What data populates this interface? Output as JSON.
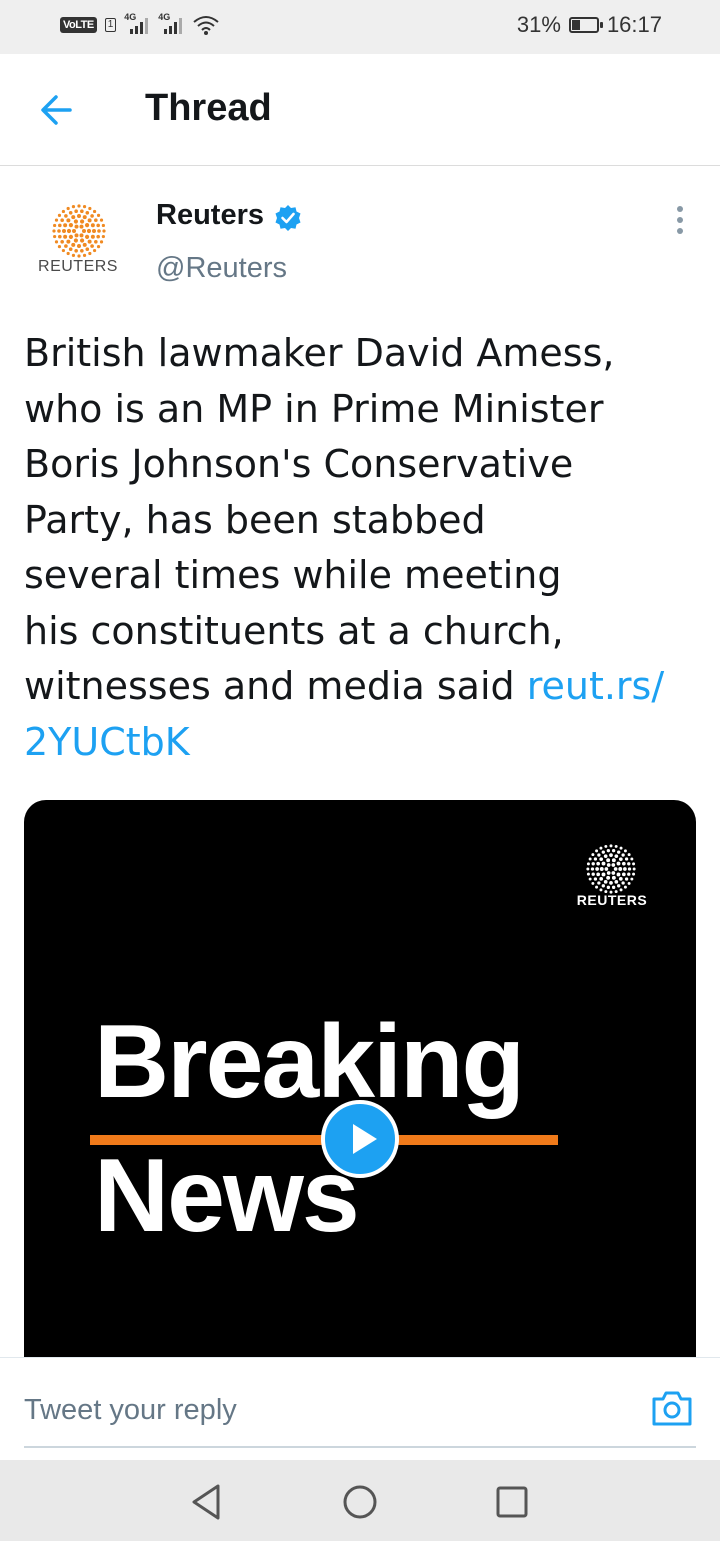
{
  "status_bar": {
    "volte": "VoLTE",
    "sim": "1",
    "network_1": "4G",
    "network_2": "4G",
    "battery": "31%",
    "battery_level": 0.31,
    "time": "16:17",
    "icons": [
      "volte-icon",
      "signal-icon",
      "signal-icon",
      "wifi-icon",
      "battery-icon"
    ]
  },
  "header": {
    "title": "Thread",
    "back_icon": "arrow-left-icon"
  },
  "tweet": {
    "author": {
      "name": "Reuters",
      "handle": "@Reuters",
      "avatar_text": "REUTERS",
      "verified": true
    },
    "text_lines": [
      "British lawmaker David Amess,",
      "who is an MP in Prime Minister",
      "Boris Johnson's Conservative",
      "Party, has been stabbed",
      "several times while meeting",
      "his constituents at a church,",
      "witnesses and media said "
    ],
    "link_part_1": "reut.rs/",
    "link_part_2": "2YUCtbK",
    "media": {
      "brand": "REUTERS",
      "headline_1": "Breaking",
      "headline_2": "News",
      "accent_color": "#f07a1a"
    }
  },
  "reply": {
    "placeholder": "Tweet your reply",
    "camera_icon": "camera-icon"
  },
  "colors": {
    "accent": "#1da1f2",
    "text": "#14171a",
    "secondary": "#657786",
    "reuters_orange": "#f08a22"
  }
}
